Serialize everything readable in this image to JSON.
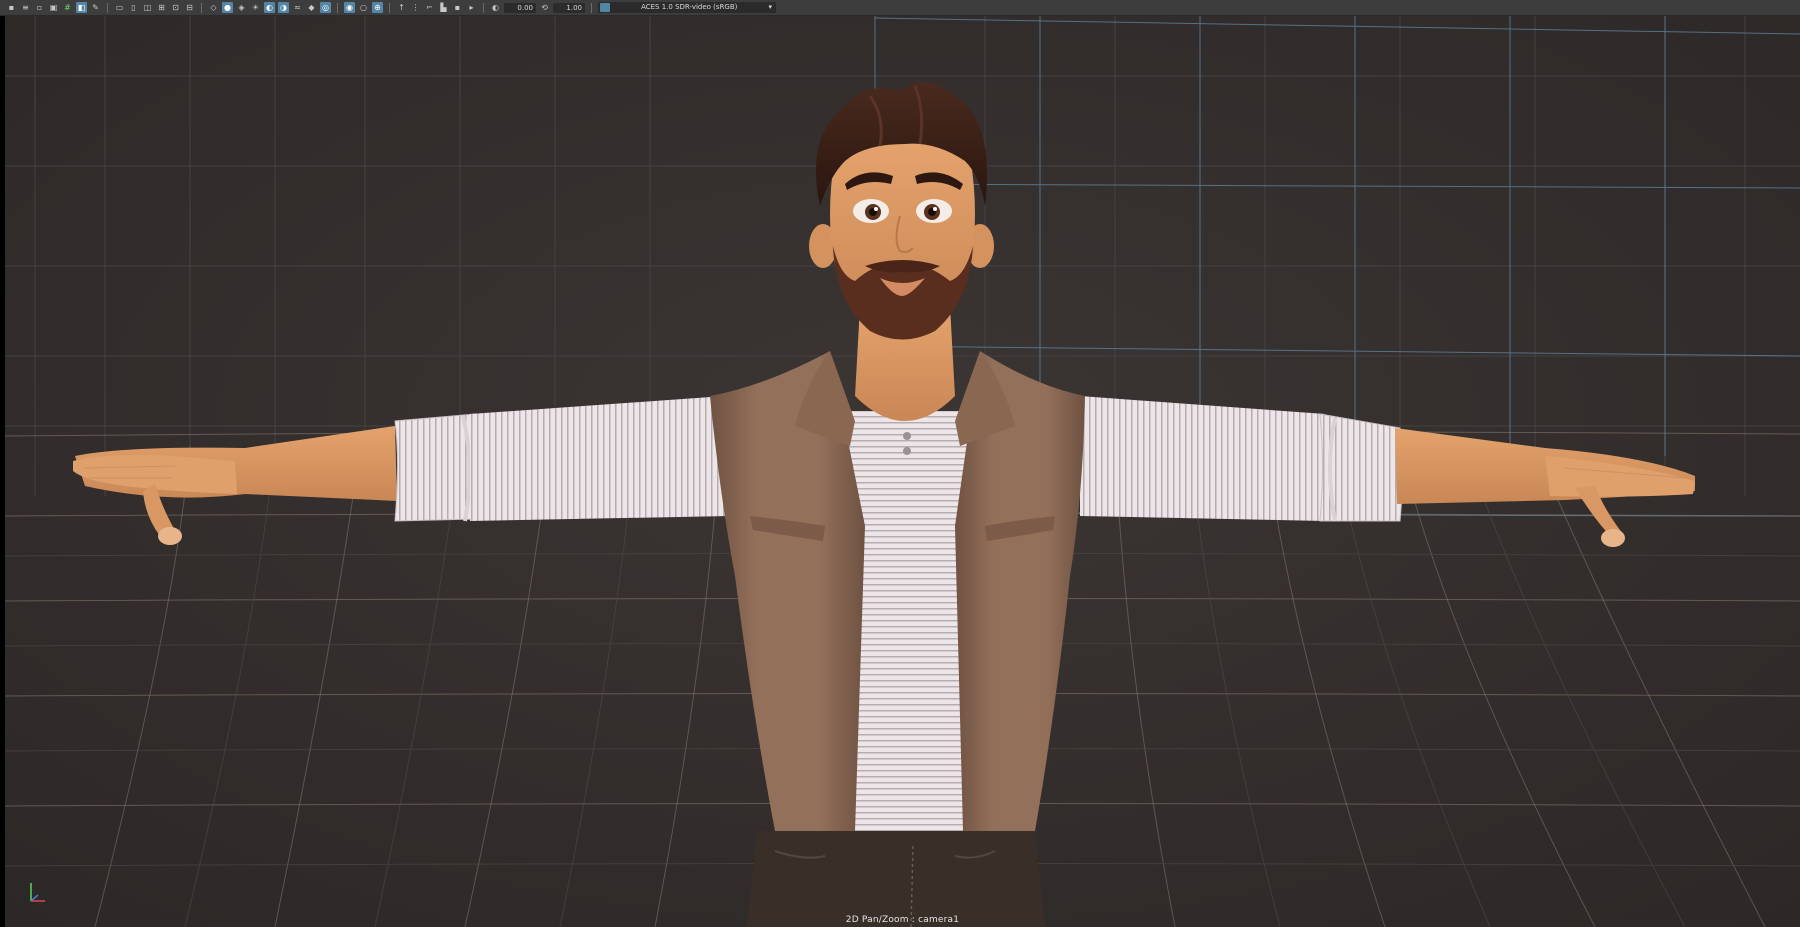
{
  "toolbar": {
    "value_field_1": "0.00",
    "value_field_2": "1.00",
    "color_space": "ACES 1.0 SDR-video (sRGB)",
    "dropdown_icon": "chevron-down-icon"
  },
  "viewport": {
    "camera_label": "2D Pan/Zoom : camera1",
    "axis_gizmo_icon": "axis-gizmo-icon",
    "colors": {
      "background": "#363130",
      "grid_major": "#5e88a6",
      "grid_horizon": "#c7b79d",
      "skin": "#d99965",
      "vest": "#8d6a52",
      "shirt": "#e8e1e3",
      "hair": "#3a2018",
      "pants": "#3a2e29"
    }
  }
}
